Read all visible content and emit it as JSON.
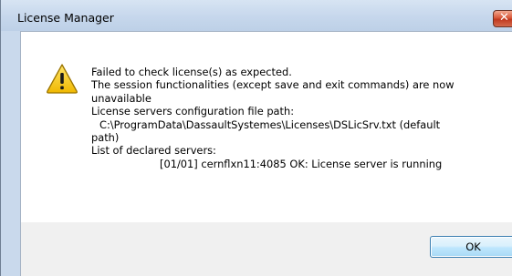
{
  "window": {
    "title": "License Manager",
    "close_glyph": "✕"
  },
  "dialog": {
    "icon": "warning-icon",
    "message_lines": [
      "Failed to check license(s) as expected.",
      "The session functionalities (except save and exit commands) are now",
      "unavailable",
      "License servers configuration file path:",
      "C:\\ProgramData\\DassaultSystemes\\Licenses\\DSLicSrv.txt (default",
      "path)",
      "List of declared servers:",
      "[01/01] cernflxn11:4085 OK: License server is running"
    ],
    "ok_label": "OK"
  },
  "colors": {
    "warning_fill": "#f5c400",
    "warning_stroke": "#9a7400",
    "button_border": "#3c7fb1"
  }
}
